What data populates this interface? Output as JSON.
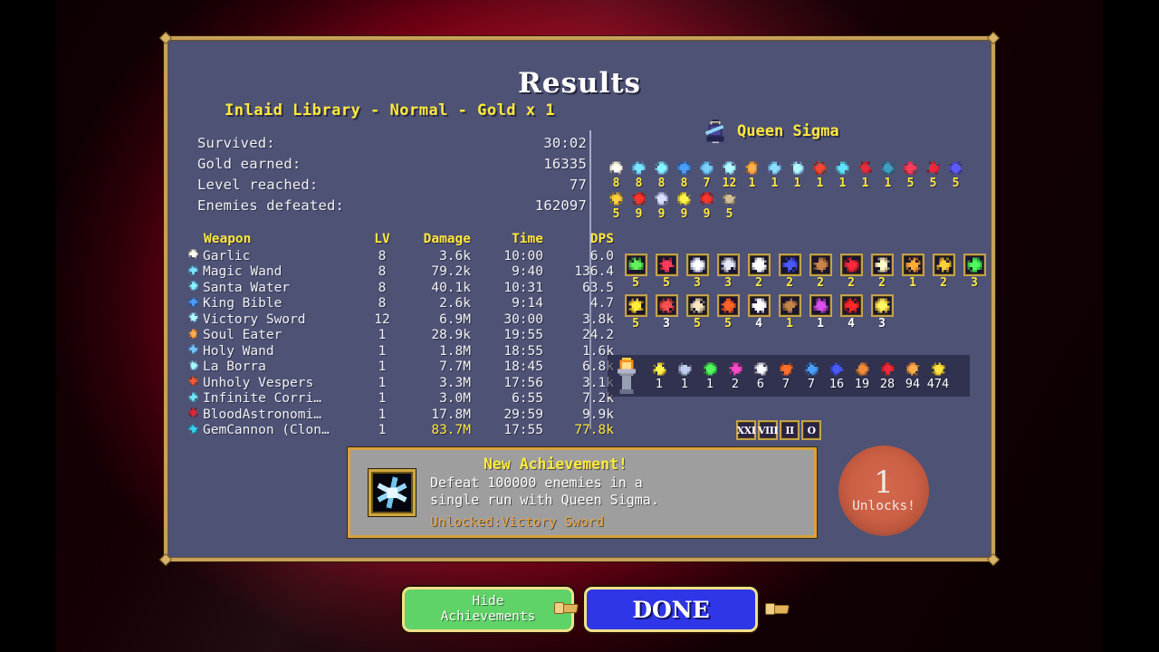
{
  "window": {
    "title": "Results"
  },
  "run": {
    "stage_line": "Inlaid Library - Normal - Gold x 1",
    "summary": [
      {
        "label": "Survived:",
        "value": "30:02"
      },
      {
        "label": "Gold earned:",
        "value": "16335"
      },
      {
        "label": "Level reached:",
        "value": "77"
      },
      {
        "label": "Enemies defeated:",
        "value": "162097"
      }
    ]
  },
  "weapon_table": {
    "headers": {
      "weapon": "Weapon",
      "lv": "LV",
      "damage": "Damage",
      "time": "Time",
      "dps": "DPS"
    },
    "rows": [
      {
        "icon": "garlic-icon",
        "name": "Garlic",
        "lv": "8",
        "damage": "3.6k",
        "time": "10:00",
        "dps": "6.0",
        "highlight": false,
        "color": "#e8e0c8"
      },
      {
        "icon": "magic-wand-icon",
        "name": "Magic Wand",
        "lv": "8",
        "damage": "79.2k",
        "time": "9:40",
        "dps": "136.4",
        "highlight": false,
        "color": "#63b8ec"
      },
      {
        "icon": "santa-water-icon",
        "name": "Santa Water",
        "lv": "8",
        "damage": "40.1k",
        "time": "10:31",
        "dps": "63.5",
        "highlight": false,
        "color": "#6fc4e8"
      },
      {
        "icon": "king-bible-icon",
        "name": "King Bible",
        "lv": "8",
        "damage": "2.6k",
        "time": "9:14",
        "dps": "4.7",
        "highlight": false,
        "color": "#3a7fd0"
      },
      {
        "icon": "victory-sword-icon",
        "name": "Victory Sword",
        "lv": "12",
        "damage": "6.9M",
        "time": "30:00",
        "dps": "3.8k",
        "highlight": false,
        "color": "#8fd6f5"
      },
      {
        "icon": "soul-eater-icon",
        "name": "Soul Eater",
        "lv": "1",
        "damage": "28.9k",
        "time": "19:55",
        "dps": "24.2",
        "highlight": false,
        "color": "#e08c3a"
      },
      {
        "icon": "holy-wand-icon",
        "name": "Holy Wand",
        "lv": "1",
        "damage": "1.8M",
        "time": "18:55",
        "dps": "1.6k",
        "highlight": false,
        "color": "#5f9ed8"
      },
      {
        "icon": "la-borra-icon",
        "name": "La Borra",
        "lv": "1",
        "damage": "7.7M",
        "time": "18:45",
        "dps": "6.8k",
        "highlight": false,
        "color": "#88c8ea"
      },
      {
        "icon": "unholy-vespers-icon",
        "name": "Unholy Vespers",
        "lv": "1",
        "damage": "3.3M",
        "time": "17:56",
        "dps": "3.1k",
        "highlight": false,
        "color": "#c04a2a"
      },
      {
        "icon": "infinite-corridor-icon",
        "name": "Infinite Corri…",
        "lv": "1",
        "damage": "3.0M",
        "time": "6:55",
        "dps": "7.2k",
        "highlight": false,
        "color": "#5ab7c8"
      },
      {
        "icon": "blood-astronomia-icon",
        "name": "BloodAstronomi…",
        "lv": "1",
        "damage": "17.8M",
        "time": "29:59",
        "dps": "9.9k",
        "highlight": false,
        "color": "#b0202a"
      },
      {
        "icon": "gem-cannon-icon",
        "name": "GemCannon (Clon…",
        "lv": "1",
        "damage": "83.7M",
        "time": "17:55",
        "dps": "77.8k",
        "highlight": true,
        "color": "#2aa8c0"
      }
    ]
  },
  "character": {
    "name": "Queen Sigma",
    "portrait": "queen-sigma-portrait"
  },
  "equipment": {
    "row1": [
      {
        "icon": "garlic-icon",
        "level": "8",
        "color": "#e8e0c8"
      },
      {
        "icon": "magic-wand-icon",
        "level": "8",
        "color": "#63b8ec"
      },
      {
        "icon": "santa-water-icon",
        "level": "8",
        "color": "#6fc4e8"
      },
      {
        "icon": "king-bible-icon",
        "level": "8",
        "color": "#3a7fd0"
      },
      {
        "icon": "runetracer-icon",
        "level": "7",
        "color": "#5fa8e0"
      },
      {
        "icon": "victory-sword-icon",
        "level": "12",
        "color": "#8fd6f5"
      },
      {
        "icon": "soul-eater-icon",
        "level": "1",
        "color": "#e08c3a"
      },
      {
        "icon": "holy-wand-icon",
        "level": "1",
        "color": "#6fb2e4"
      },
      {
        "icon": "la-borra-icon",
        "level": "1",
        "color": "#8ec9ee"
      },
      {
        "icon": "unholy-vespers-icon",
        "level": "1",
        "color": "#c23a28"
      },
      {
        "icon": "infinite-corridor-icon",
        "level": "1",
        "color": "#4fb5cc"
      },
      {
        "icon": "crimson-shroud-icon",
        "level": "1",
        "color": "#b82230"
      },
      {
        "icon": "vento-sacro-icon",
        "level": "1",
        "color": "#2f7f9c"
      },
      {
        "icon": "heart-icon",
        "level": "5",
        "color": "#e03048"
      },
      {
        "icon": "tome-icon",
        "level": "5",
        "color": "#c02030"
      },
      {
        "icon": "orb-icon",
        "level": "5",
        "color": "#4a49c8"
      }
    ],
    "row2": [
      {
        "icon": "cage-icon",
        "level": "5",
        "color": "#d8a62c"
      },
      {
        "icon": "arrow-red-icon",
        "level": "9",
        "color": "#cc2a24"
      },
      {
        "icon": "ring-icon",
        "level": "9",
        "color": "#b0b4e0"
      },
      {
        "icon": "amulet-icon",
        "level": "9",
        "color": "#d6c438"
      },
      {
        "icon": "arrow-left-icon",
        "level": "9",
        "color": "#cc2a24"
      },
      {
        "icon": "armor-icon",
        "level": "5",
        "color": "#a89878"
      }
    ]
  },
  "powerups": {
    "row1": [
      {
        "icon": "spinach-icon",
        "value": "5",
        "white": false,
        "color": "#4fc04a"
      },
      {
        "icon": "hollow-heart-icon",
        "value": "5",
        "white": false,
        "color": "#d83048"
      },
      {
        "icon": "armor-powerup-icon",
        "value": "3",
        "white": false,
        "color": "#cfd4e8"
      },
      {
        "icon": "clover-icon",
        "value": "3",
        "white": false,
        "color": "#b8bcc8"
      },
      {
        "icon": "wings-icon",
        "value": "2",
        "white": false,
        "color": "#f0f0f0"
      },
      {
        "icon": "duplicator-icon",
        "value": "2",
        "white": false,
        "color": "#3a48e0"
      },
      {
        "icon": "candelabrador-icon",
        "value": "2",
        "white": false,
        "color": "#a06b3a"
      },
      {
        "icon": "bracer-icon",
        "value": "2",
        "white": false,
        "color": "#cc2030"
      },
      {
        "icon": "empty-tome-icon",
        "value": "2",
        "white": false,
        "color": "#d8c8a0"
      },
      {
        "icon": "attractorb-icon",
        "value": "1",
        "white": false,
        "color": "#e08a2a"
      },
      {
        "icon": "tiragisu-icon",
        "value": "2",
        "white": false,
        "color": "#d8a62c"
      },
      {
        "icon": "clover-green-icon",
        "value": "3",
        "white": false,
        "color": "#3ec84a"
      }
    ],
    "row2": [
      {
        "icon": "crown-icon",
        "value": "5",
        "white": false,
        "color": "#e8c02c"
      },
      {
        "icon": "stone-mask-icon",
        "value": "3",
        "white": true,
        "color": "#d04040"
      },
      {
        "icon": "skull-o-maniac-icon",
        "value": "5",
        "white": false,
        "color": "#c8b898"
      },
      {
        "icon": "pummarola-icon",
        "value": "5",
        "white": false,
        "color": "#e05020"
      },
      {
        "icon": "silver-ring-icon",
        "value": "4",
        "white": true,
        "color": "#e8e8f0"
      },
      {
        "icon": "gold-ring-icon",
        "value": "1",
        "white": false,
        "color": "#9c6a3a"
      },
      {
        "icon": "metaglio-left-icon",
        "value": "1",
        "white": true,
        "color": "#b040c0"
      },
      {
        "icon": "metaglio-right-icon",
        "value": "4",
        "white": true,
        "color": "#e02020"
      },
      {
        "icon": "gold-bar-icon",
        "value": "3",
        "white": true,
        "color": "#e8c84c"
      }
    ]
  },
  "collectibles": {
    "torch_icon": "flame-torch-icon",
    "items": [
      {
        "icon": "gold-clover-icon",
        "count": "1",
        "color": "#e0c438"
      },
      {
        "icon": "chest-icon",
        "count": "1",
        "color": "#9aa4c0"
      },
      {
        "icon": "green-clover-icon",
        "count": "1",
        "color": "#3ec84a"
      },
      {
        "icon": "pink-pouch-icon",
        "count": "2",
        "color": "#d63aa0"
      },
      {
        "icon": "clock-icon",
        "count": "6",
        "color": "#c8c8d0"
      },
      {
        "icon": "orange-gem-icon",
        "count": "7",
        "color": "#e05a20"
      },
      {
        "icon": "blue-cross-icon",
        "count": "7",
        "color": "#3a7fd0"
      },
      {
        "icon": "blue-orb-icon",
        "count": "16",
        "color": "#3a48e0"
      },
      {
        "icon": "treasure-icon",
        "count": "19",
        "color": "#c07030"
      },
      {
        "icon": "red-pouch-icon",
        "count": "28",
        "color": "#c02030"
      },
      {
        "icon": "roast-chicken-icon",
        "count": "94",
        "color": "#e08a3a"
      },
      {
        "icon": "gold-coin-icon",
        "count": "474",
        "color": "#e0b830"
      }
    ]
  },
  "arcana": [
    {
      "label": "XXI",
      "name": "arcana-card-xxi"
    },
    {
      "label": "VIII",
      "name": "arcana-card-viii"
    },
    {
      "label": "II",
      "name": "arcana-card-ii"
    },
    {
      "label": "O",
      "name": "arcana-card-o"
    }
  ],
  "achievement": {
    "title": "New Achievement!",
    "description_line1": "Defeat 100000 enemies in a",
    "description_line2": "single run with Queen Sigma.",
    "unlocked": "Unlocked:Victory Sword",
    "icon": "victory-sword-achievement-icon"
  },
  "unlocks_badge": {
    "count": "1",
    "label": "Unlocks!"
  },
  "buttons": {
    "hide_achievements_line1": "Hide",
    "hide_achievements_line2": "Achievements",
    "done": "DONE"
  },
  "colors": {
    "panel_bg": "#4e5275",
    "panel_border": "#c8a158",
    "accent_yellow": "#ffe93f",
    "accent_orange": "#f0a63c",
    "button_green": "#5fd268",
    "button_blue": "#2f36e8",
    "backdrop_red": "#e00025"
  }
}
